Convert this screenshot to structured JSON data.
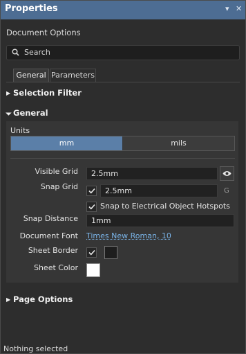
{
  "panel": {
    "title": "Properties",
    "pin_glyph": "▾",
    "close_glyph": "✕",
    "subtitle": "Document Options"
  },
  "search": {
    "placeholder": "Search"
  },
  "tabs": [
    {
      "label": "General",
      "active": true
    },
    {
      "label": "Parameters",
      "active": false
    }
  ],
  "sections": {
    "selection_filter": "Selection Filter",
    "general": "General",
    "page_options": "Page Options"
  },
  "units": {
    "label": "Units",
    "options": [
      "mm",
      "mils"
    ],
    "selected": "mm"
  },
  "fields": {
    "visible_grid": {
      "label": "Visible Grid",
      "value": "2.5mm"
    },
    "snap_grid": {
      "label": "Snap Grid",
      "value": "2.5mm",
      "checked": true,
      "suffix": "G"
    },
    "snap_hotspots": {
      "label": "Snap to Electrical Object Hotspots",
      "checked": true
    },
    "snap_distance": {
      "label": "Snap Distance",
      "value": "1mm"
    },
    "document_font": {
      "label": "Document Font",
      "value": "Times New Roman, 10"
    },
    "sheet_border": {
      "label": "Sheet Border",
      "checked": true,
      "color": "#1e1e1e"
    },
    "sheet_color": {
      "label": "Sheet Color",
      "color": "#ffffff"
    }
  },
  "status": "Nothing selected",
  "icons": {
    "search": "search-icon",
    "eye": "eye-icon",
    "check": "checkmark-icon"
  },
  "colors": {
    "titlebar": "#4d6d93",
    "accent": "#5b7fa8",
    "link": "#7ab4e8"
  }
}
